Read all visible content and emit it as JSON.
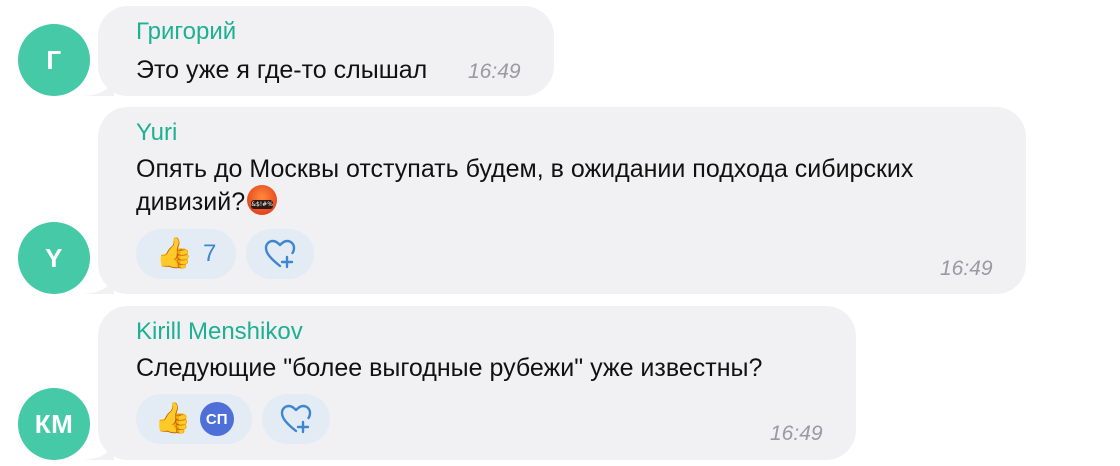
{
  "messages": [
    {
      "avatar_initials": "Г",
      "sender": "Григорий",
      "text": "Это уже я где-то слышал",
      "time": "16:49"
    },
    {
      "avatar_initials": "Y",
      "sender": "Yuri",
      "text_line1": "Опять до Москвы отступать будем, в ожидании подхода сибирских",
      "text_line2": "дивизий?",
      "emoji_text": "&$!#%",
      "time": "16:49",
      "reaction_count": "7"
    },
    {
      "avatar_initials": "КМ",
      "sender": "Kirill Menshikov",
      "text": "Следующие \"более выгодные рубежи\" уже известны?",
      "reactor_initials": "СП",
      "time": "16:49"
    }
  ],
  "colors": {
    "avatar": "#45c9a6",
    "sender": "#1db093",
    "bubble": "#f1f1f3",
    "reaction_bg": "#e3ebf5",
    "reaction_count": "#3e86d0"
  },
  "icons": {
    "thumbs_up": "👍",
    "add_reaction": "heart-plus-icon"
  }
}
